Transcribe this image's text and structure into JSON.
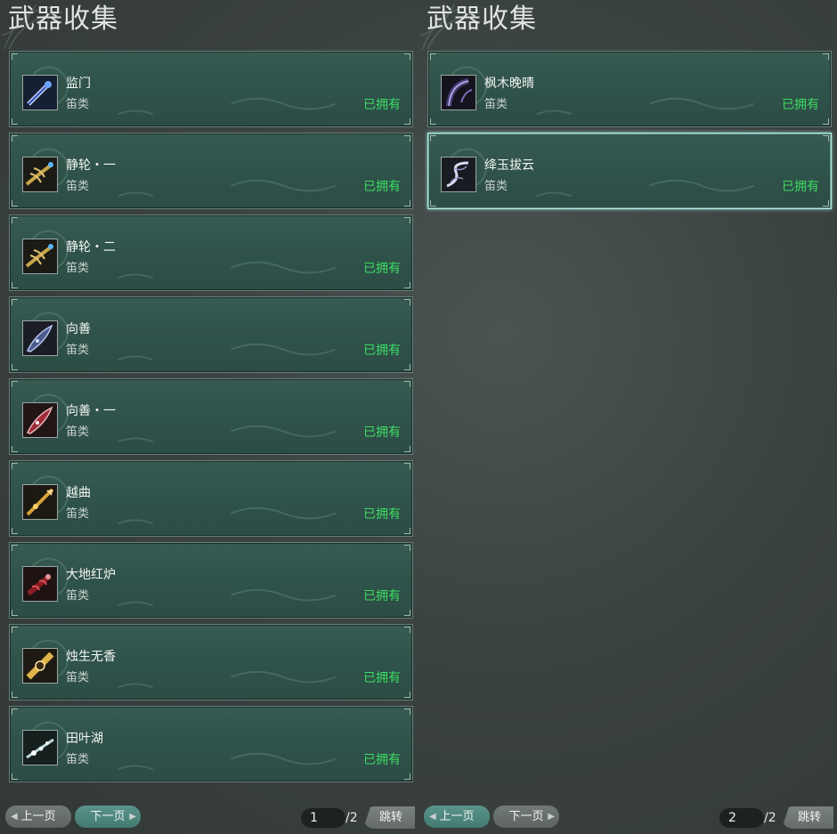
{
  "left_panel": {
    "title": "武器收集",
    "items": [
      {
        "name": "监门",
        "type": "笛类",
        "status": "已拥有",
        "icon": "blue-silver-flute-icon"
      },
      {
        "name": "静轮・一",
        "type": "笛类",
        "status": "已拥有",
        "icon": "golden-claw-flute-icon"
      },
      {
        "name": "静轮・二",
        "type": "笛类",
        "status": "已拥有",
        "icon": "golden-claw-flute-icon"
      },
      {
        "name": "向善",
        "type": "笛类",
        "status": "已拥有",
        "icon": "blue-blade-flute-icon"
      },
      {
        "name": "向善・一",
        "type": "笛类",
        "status": "已拥有",
        "icon": "red-blade-flute-icon"
      },
      {
        "name": "越曲",
        "type": "笛类",
        "status": "已拥有",
        "icon": "golden-spear-flute-icon"
      },
      {
        "name": "大地红炉",
        "type": "笛类",
        "status": "已拥有",
        "icon": "red-forge-flute-icon"
      },
      {
        "name": "烛生无香",
        "type": "笛类",
        "status": "已拥有",
        "icon": "golden-ornate-flute-icon"
      },
      {
        "name": "田叶湖",
        "type": "笛类",
        "status": "已拥有",
        "icon": "white-flower-flute-icon"
      }
    ],
    "pager": {
      "prev": "上一页",
      "next": "下一页",
      "current_page": "1",
      "total": "/2",
      "jump": "跳转"
    }
  },
  "right_panel": {
    "title": "武器收集",
    "items": [
      {
        "name": "枫木晚晴",
        "type": "笛类",
        "status": "已拥有",
        "icon": "dark-purple-flute-icon"
      },
      {
        "name": "绛玉拔云",
        "type": "笛类",
        "status": "已拥有",
        "icon": "silver-dragon-flute-icon",
        "selected": true
      }
    ],
    "pager": {
      "prev": "上一页",
      "next": "下一页",
      "current_page": "2",
      "total": "/2",
      "jump": "跳转"
    }
  },
  "colors": {
    "owned_status": "#3ddc62",
    "card_background": "#2f524a",
    "selected_border": "#b8ece4",
    "prev_button_active_page1": "#727a78",
    "next_button_active_page1": "#5a948a"
  }
}
